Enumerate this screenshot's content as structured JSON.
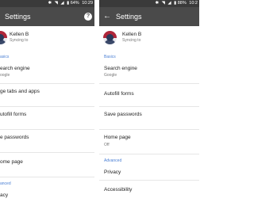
{
  "left": {
    "status": {
      "battery": "64%",
      "time": "10:29"
    },
    "title": "Settings",
    "account": {
      "name": "Kellen B",
      "status": "Syncing to"
    },
    "basics_header": "asics",
    "items": [
      {
        "title": "earch engine",
        "subtitle": "oogle"
      },
      {
        "title": "ge tabs and apps",
        "subtitle": ""
      },
      {
        "title": "utofill forms",
        "subtitle": ""
      },
      {
        "title": "e passwords",
        "subtitle": ""
      },
      {
        "title": "ome page",
        "subtitle": ""
      }
    ],
    "advanced_header": "anced",
    "advanced_items": [
      {
        "title": "acy"
      }
    ]
  },
  "right": {
    "status": {
      "battery": "88%",
      "time": "10:2"
    },
    "title": "Settings",
    "account": {
      "name": "Kellen B",
      "status": "Syncing to"
    },
    "basics_header": "Basics",
    "items": [
      {
        "title": "Search engine",
        "subtitle": "Google"
      },
      {
        "title": "Autofill forms",
        "subtitle": ""
      },
      {
        "title": "Save passwords",
        "subtitle": ""
      },
      {
        "title": "Home page",
        "subtitle": "Off"
      }
    ],
    "advanced_header": "Advanced",
    "advanced_items": [
      {
        "title": "Privacy"
      },
      {
        "title": "Accessibility"
      }
    ]
  },
  "colors": {
    "toolbar": "#4a4a4a",
    "statusbar": "#3a3a3a",
    "section_header": "#4a7fd4",
    "avatar_red": "#b0263a"
  }
}
